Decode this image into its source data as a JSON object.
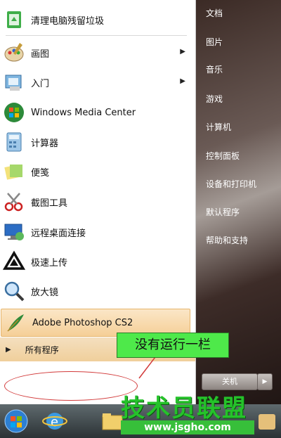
{
  "programs": [
    {
      "label": "清理电脑残留垃圾",
      "icon": "recycle-bin-icon"
    },
    {
      "label": "画图",
      "icon": "paint-palette-icon",
      "has_submenu": true
    },
    {
      "label": "入门",
      "icon": "getting-started-icon",
      "has_submenu": true
    },
    {
      "label": "Windows Media Center",
      "icon": "windows-media-center-icon"
    },
    {
      "label": "计算器",
      "icon": "calculator-icon"
    },
    {
      "label": "便笺",
      "icon": "sticky-notes-icon"
    },
    {
      "label": "截图工具",
      "icon": "snipping-tool-icon"
    },
    {
      "label": "远程桌面连接",
      "icon": "remote-desktop-icon"
    },
    {
      "label": "极速上传",
      "icon": "upload-icon"
    },
    {
      "label": "放大镜",
      "icon": "magnifier-icon"
    },
    {
      "label": "Adobe Photoshop CS2",
      "icon": "photoshop-feather-icon",
      "highlighted": true
    }
  ],
  "all_programs": {
    "label": "所有程序"
  },
  "right_links": [
    "文档",
    "图片",
    "音乐",
    "游戏",
    "计算机",
    "控制面板",
    "设备和打印机",
    "默认程序",
    "帮助和支持"
  ],
  "shutdown": {
    "label": "关机"
  },
  "annotation": {
    "text": "没有运行一栏"
  },
  "watermark": {
    "text": "技术员联盟",
    "url": "www.jsgho.com"
  },
  "colors": {
    "highlight": "#f5cf97",
    "annotation_bg": "#4ee94a",
    "annotation_ring": "#d23a3a",
    "watermark": "#25c22a"
  }
}
